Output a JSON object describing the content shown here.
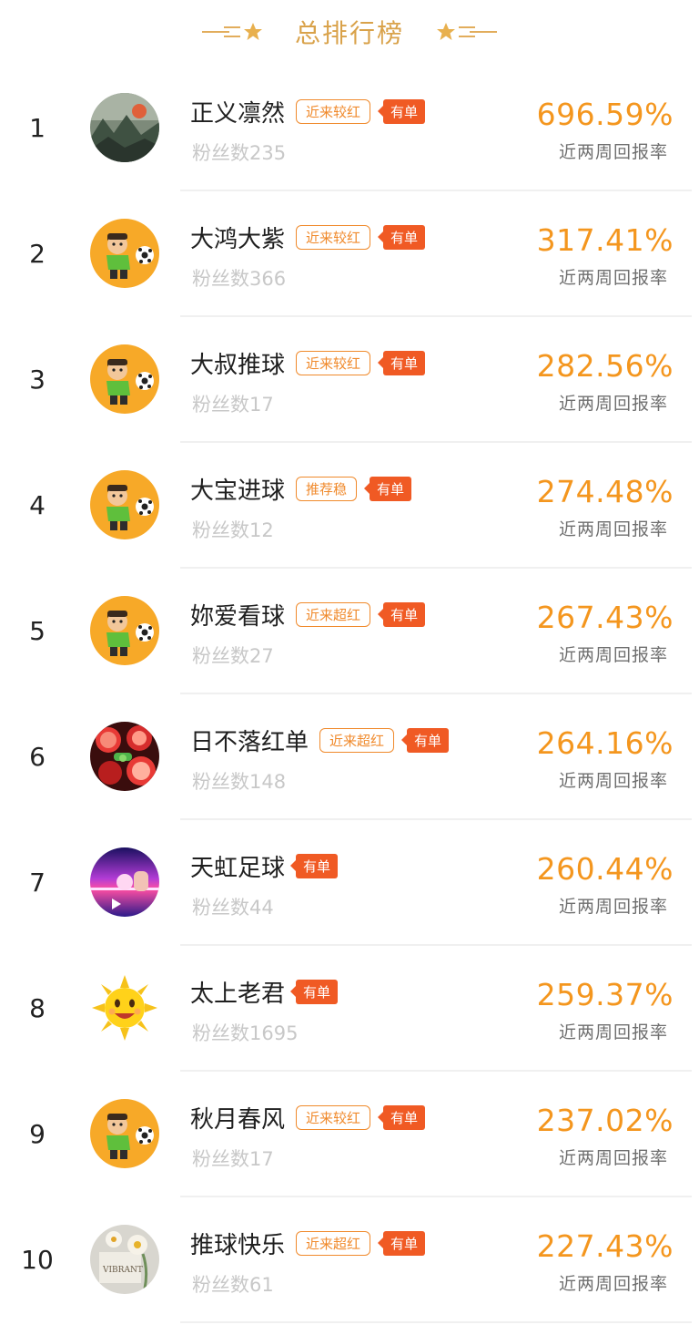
{
  "header": {
    "title": "总排行榜"
  },
  "rows": [
    {
      "rank": "1",
      "name": "正义凛然",
      "tag": "近来较红",
      "badge": "有单",
      "fans": "粉丝数235",
      "rate": "696.59%",
      "rate_label": "近两周回报率",
      "avatar": "landscape-avatar"
    },
    {
      "rank": "2",
      "name": "大鸿大紫",
      "tag": "近来较红",
      "badge": "有单",
      "fans": "粉丝数366",
      "rate": "317.41%",
      "rate_label": "近两周回报率",
      "avatar": "soccer-player-avatar"
    },
    {
      "rank": "3",
      "name": "大叔推球",
      "tag": "近来较红",
      "badge": "有单",
      "fans": "粉丝数17",
      "rate": "282.56%",
      "rate_label": "近两周回报率",
      "avatar": "soccer-player-avatar"
    },
    {
      "rank": "4",
      "name": "大宝进球",
      "tag": "推荐稳",
      "badge": "有单",
      "fans": "粉丝数12",
      "rate": "274.48%",
      "rate_label": "近两周回报率",
      "avatar": "soccer-player-avatar"
    },
    {
      "rank": "5",
      "name": "妳爱看球",
      "tag": "近来超红",
      "badge": "有单",
      "fans": "粉丝数27",
      "rate": "267.43%",
      "rate_label": "近两周回报率",
      "avatar": "soccer-player-avatar"
    },
    {
      "rank": "6",
      "name": "日不落红单",
      "tag": "近来超红",
      "badge": "有单",
      "fans": "粉丝数148",
      "rate": "264.16%",
      "rate_label": "近两周回报率",
      "avatar": "fruit-avatar"
    },
    {
      "rank": "7",
      "name": "天虹足球",
      "tag": "",
      "badge": "有单",
      "fans": "粉丝数44",
      "rate": "260.44%",
      "rate_label": "近两周回报率",
      "avatar": "neon-avatar"
    },
    {
      "rank": "8",
      "name": "太上老君",
      "tag": "",
      "badge": "有单",
      "fans": "粉丝数1695",
      "rate": "259.37%",
      "rate_label": "近两周回报率",
      "avatar": "sun-avatar"
    },
    {
      "rank": "9",
      "name": "秋月春风",
      "tag": "近来较红",
      "badge": "有单",
      "fans": "粉丝数17",
      "rate": "237.02%",
      "rate_label": "近两周回报率",
      "avatar": "soccer-player-avatar"
    },
    {
      "rank": "10",
      "name": "推球快乐",
      "tag": "近来超红",
      "badge": "有单",
      "fans": "粉丝数61",
      "rate": "227.43%",
      "rate_label": "近两周回报率",
      "avatar": "flower-avatar"
    }
  ]
}
